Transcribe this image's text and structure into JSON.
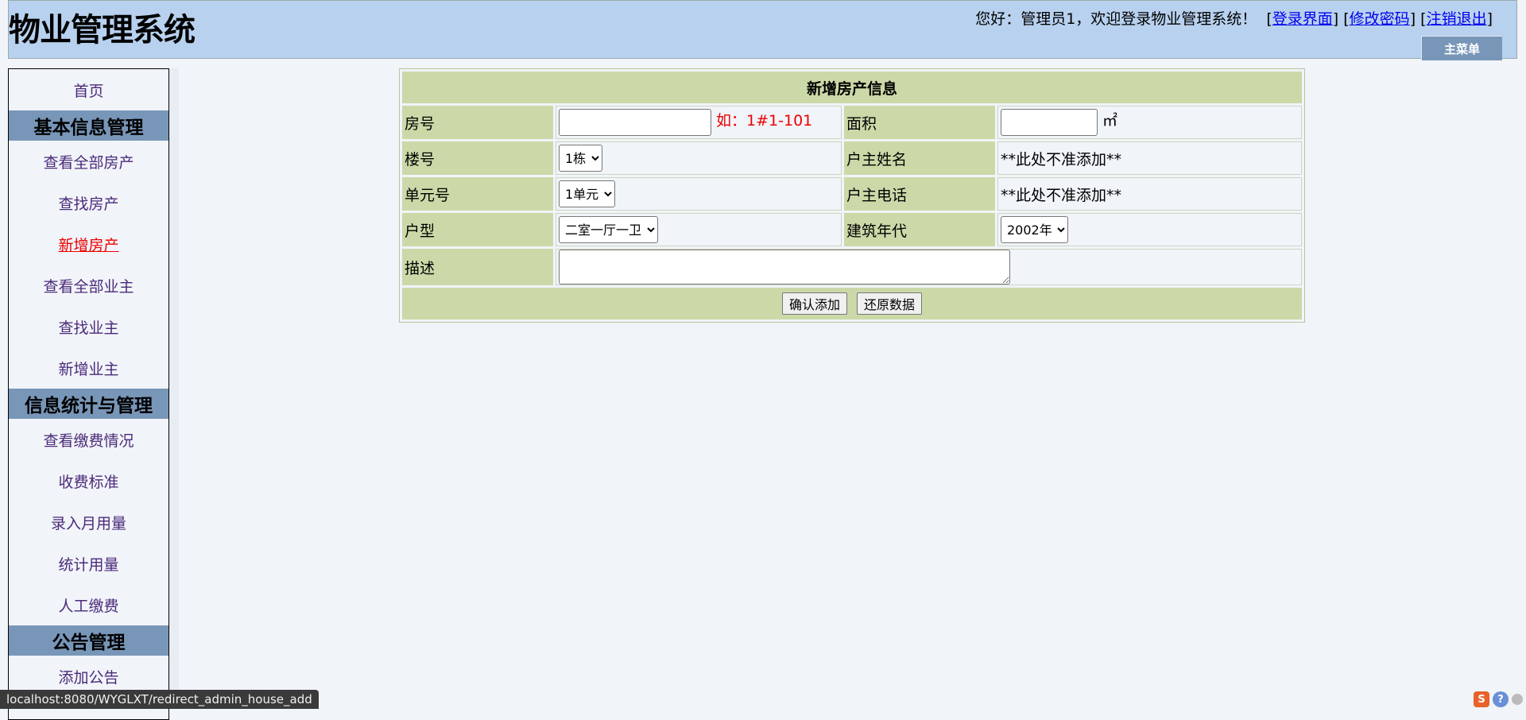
{
  "header": {
    "title": "物业管理系统",
    "welcome_text": "您好：管理员1，欢迎登录物业管理系统！",
    "links": [
      "登录界面",
      "修改密码",
      "注销退出"
    ],
    "menu_tab": "主菜单"
  },
  "sidebar": {
    "home": "首页",
    "sections": [
      {
        "title": "基本信息管理",
        "items": [
          "查看全部房产",
          "查找房产",
          "新增房产",
          "查看全部业主",
          "查找业主",
          "新增业主"
        ]
      },
      {
        "title": "信息统计与管理",
        "items": [
          "查看缴费情况",
          "收费标准",
          "录入月用量",
          "统计用量",
          "人工缴费"
        ]
      },
      {
        "title": "公告管理",
        "items": [
          "添加公告"
        ]
      }
    ],
    "active_item": "新增房产"
  },
  "form": {
    "title": "新增房产信息",
    "room_label": "房号",
    "room_value": "",
    "room_hint": "如：1#1-101",
    "area_label": "面积",
    "area_value": "",
    "area_unit": "㎡",
    "building_label": "楼号",
    "building_selected": "1栋",
    "owner_name_label": "户主姓名",
    "owner_name_note": "**此处不准添加**",
    "unit_label": "单元号",
    "unit_selected": "1单元",
    "owner_phone_label": "户主电话",
    "owner_phone_note": "**此处不准添加**",
    "layout_label": "户型",
    "layout_selected": "二室一厅一卫",
    "year_label": "建筑年代",
    "year_selected": "2002年",
    "desc_label": "描述",
    "desc_value": "",
    "confirm_button": "确认添加",
    "reset_button": "还原数据"
  },
  "status_bar": {
    "url": "localhost:8080/WYGLXT/redirect_admin_house_add"
  }
}
